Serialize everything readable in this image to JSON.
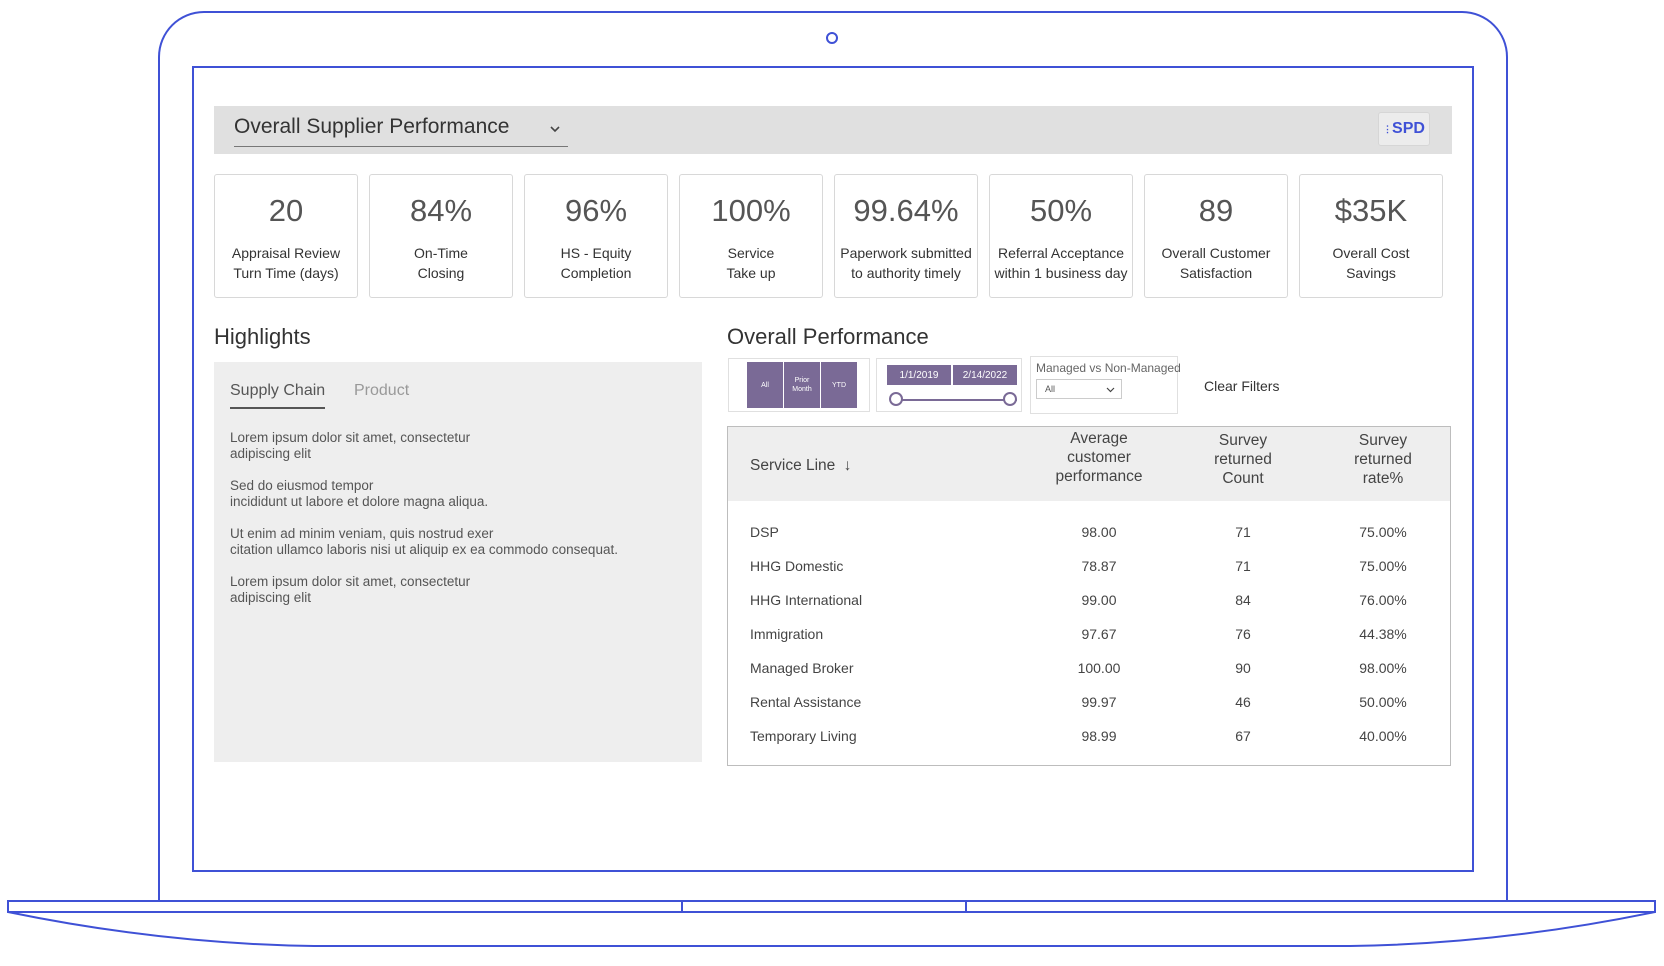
{
  "header": {
    "title": "Overall Supplier Performance",
    "logo_text": "SPD"
  },
  "kpis": [
    {
      "value": "20",
      "label": "Appraisal Review\nTurn Time (days)"
    },
    {
      "value": "84%",
      "label": "On-Time\nClosing"
    },
    {
      "value": "96%",
      "label": "HS - Equity\nCompletion"
    },
    {
      "value": "100%",
      "label": "Service\nTake up"
    },
    {
      "value": "99.64%",
      "label": "Paperwork submitted\nto authority timely"
    },
    {
      "value": "50%",
      "label": "Referral Acceptance\nwithin 1 business day"
    },
    {
      "value": "89",
      "label": "Overall Customer\nSatisfaction"
    },
    {
      "value": "$35K",
      "label": "Overall Cost\nSavings"
    }
  ],
  "highlights": {
    "title": "Highlights",
    "tabs": [
      {
        "label": "Supply Chain",
        "active": true
      },
      {
        "label": "Product",
        "active": false
      }
    ],
    "paragraphs": [
      "Lorem ipsum dolor sit amet, consectetur\nadipiscing elit",
      "Sed do eiusmod tempor\nincididunt ut labore et dolore magna aliqua.",
      "Ut enim ad minim veniam, quis nostrud exer\ncitation ullamco laboris nisi ut aliquip ex ea commodo consequat.",
      "Lorem ipsum dolor sit amet, consectetur\nadipiscing elit"
    ]
  },
  "performance": {
    "title": "Overall Performance",
    "period_buttons": [
      "All",
      "Prior Month",
      "YTD"
    ],
    "date_start": "1/1/2019",
    "date_end": "2/14/2022",
    "managed_filter": {
      "label": "Managed vs Non-Managed",
      "value": "All"
    },
    "clear_filters": "Clear Filters",
    "table": {
      "columns": [
        "Service Line",
        "Average\ncustomer\nperformance",
        "Survey\nreturned\nCount",
        "Survey\nreturned\nrate%"
      ],
      "rows": [
        [
          "DSP",
          "98.00",
          "71",
          "75.00%"
        ],
        [
          "HHG Domestic",
          "78.87",
          "71",
          "75.00%"
        ],
        [
          "HHG International",
          "99.00",
          "84",
          "76.00%"
        ],
        [
          "Immigration",
          "97.67",
          "76",
          "44.38%"
        ],
        [
          "Managed Broker",
          "100.00",
          "90",
          "98.00%"
        ],
        [
          "Rental Assistance",
          "99.97",
          "46",
          "50.00%"
        ],
        [
          "Temporary Living",
          "98.99",
          "67",
          "40.00%"
        ]
      ]
    }
  },
  "colors": {
    "device_outline": "#3f51d6",
    "accent_purple": "#7a6a96",
    "header_bg": "#e0e0e0",
    "panel_bg": "#eeeeee"
  }
}
